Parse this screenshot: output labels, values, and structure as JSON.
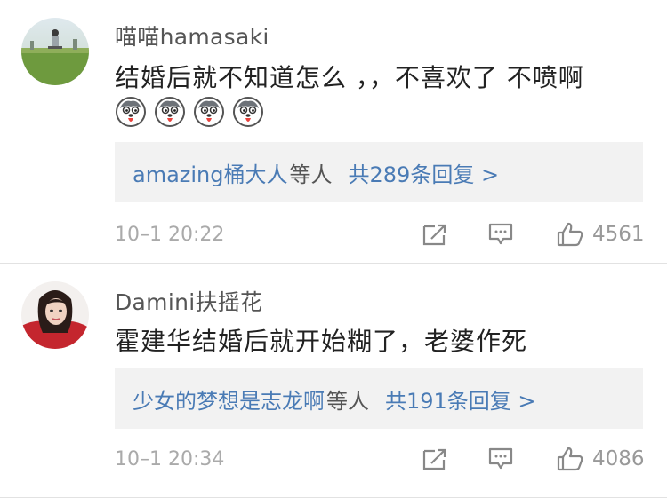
{
  "comments": [
    {
      "username": "喵喵hamasaki",
      "text": "结婚后就不知道怎么 ，，不喜欢了  不喷啊",
      "emojis": [
        "husky-tongue-emoji",
        "husky-tongue-emoji",
        "husky-tongue-emoji",
        "husky-tongue-emoji"
      ],
      "reply_names": "amazing桶大人",
      "reply_suffix": "等人",
      "reply_count": "共289条回复 >",
      "timestamp": "10–1 20:22",
      "likes": "4561"
    },
    {
      "username": "Damini扶摇花",
      "text": "霍建华结婚后就开始糊了，老婆作死",
      "reply_names": "少女的梦想是志龙啊",
      "reply_suffix": "等人",
      "reply_count": "共191条回复 >",
      "timestamp": "10–1 20:34",
      "likes": "4086"
    }
  ],
  "colors": {
    "link": "#4a7bb5",
    "reply_bg": "#f2f2f2",
    "meta": "#aaaaaa"
  },
  "icons": [
    "share-icon",
    "comment-icon",
    "like-icon"
  ]
}
